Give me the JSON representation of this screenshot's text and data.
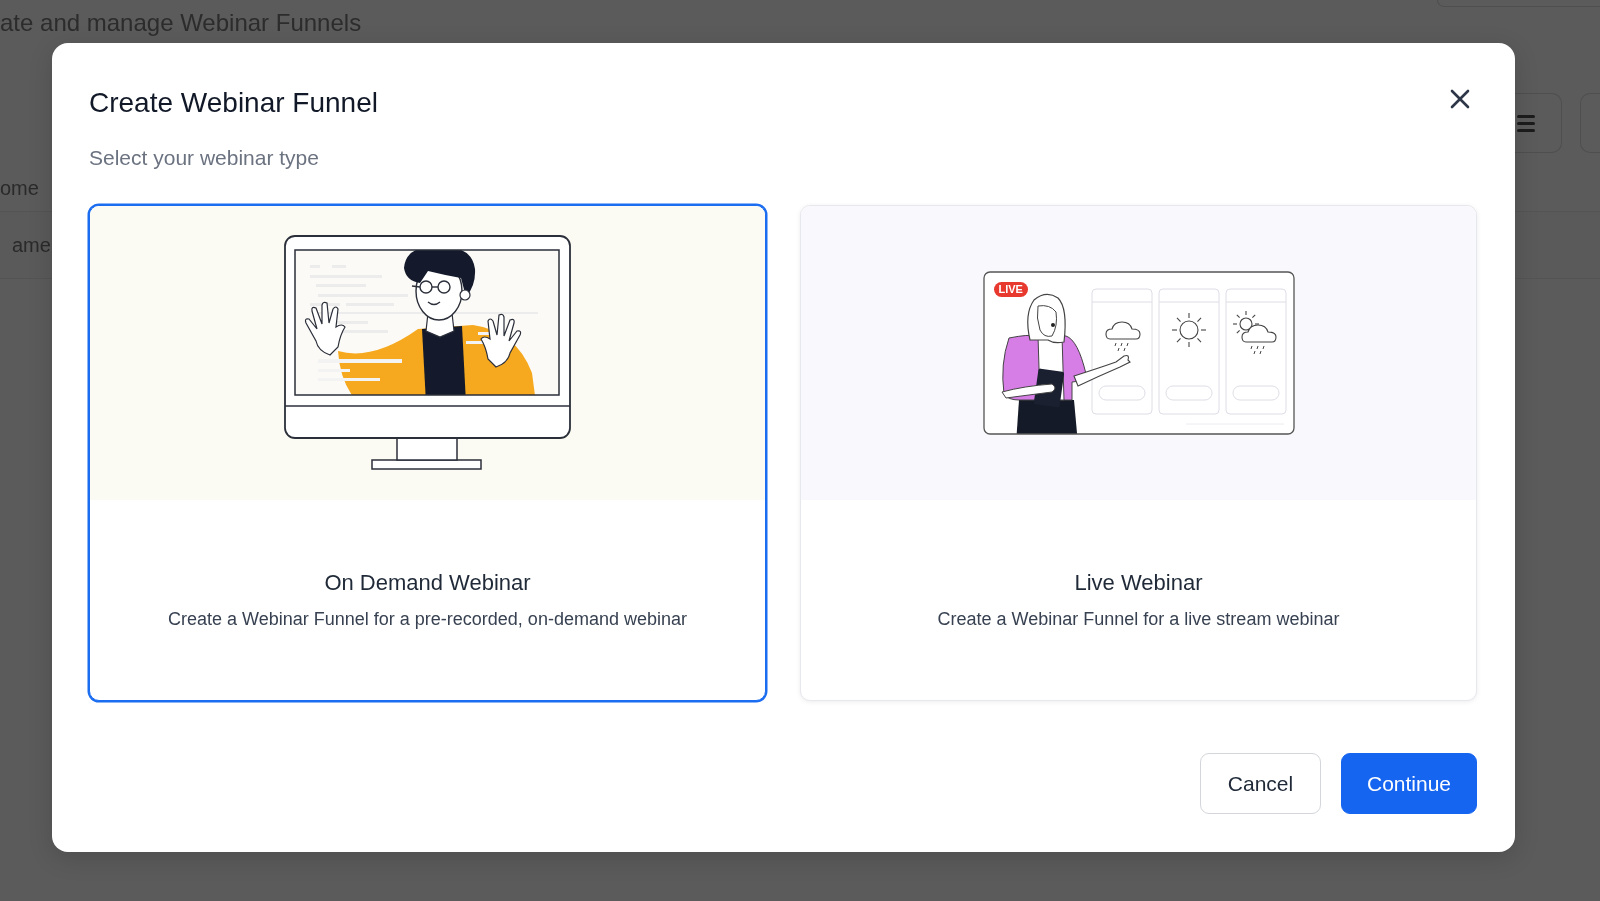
{
  "background": {
    "heading": "ate and manage Webinar Funnels",
    "labels": [
      "ome",
      "ame"
    ]
  },
  "dialog": {
    "title": "Create Webinar Funnel",
    "subtitle": "Select your webinar type",
    "options": [
      {
        "kind": "on_demand",
        "title": "On Demand Webinar",
        "description": "Create a Webinar Funnel for a pre-recorded, on-demand webinar",
        "selected": true
      },
      {
        "kind": "live",
        "badge": "LIVE",
        "title": "Live Webinar",
        "description": "Create a Webinar Funnel for a live stream webinar",
        "selected": false
      }
    ],
    "buttons": [
      {
        "kind": "secondary",
        "label": "Cancel"
      },
      {
        "kind": "primary",
        "label": "Continue"
      }
    ]
  }
}
